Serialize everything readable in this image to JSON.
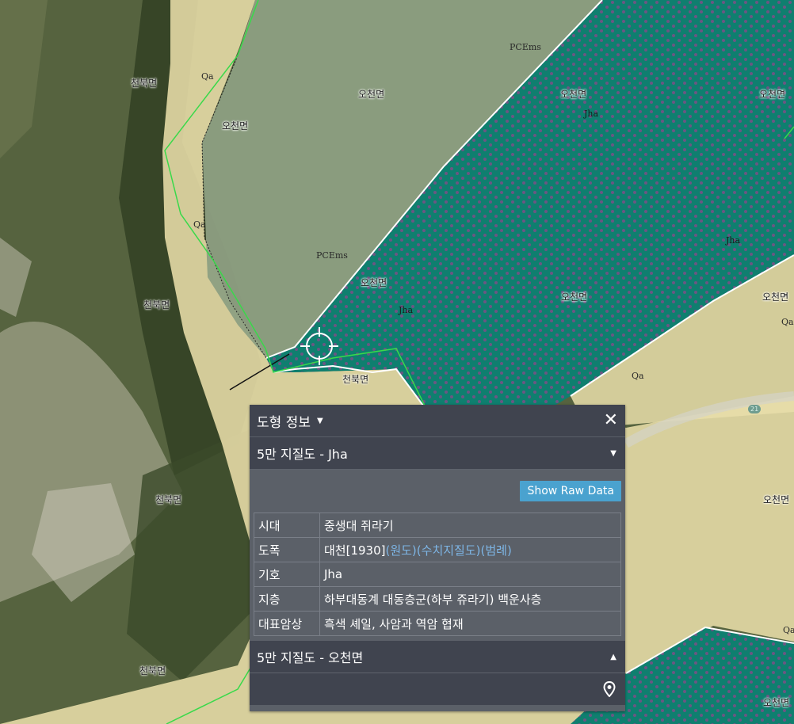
{
  "map": {
    "place_labels": [
      "천북면",
      "오천면",
      "천북면",
      "천북면",
      "오천면",
      "오천면",
      "천북면",
      "오천면",
      "오천면",
      "오천면",
      "오천면",
      "오천면",
      "오천면",
      "천북면"
    ],
    "unit_labels": [
      "PCEms",
      "PCEms",
      "Qa",
      "Qa",
      "Jha",
      "Jha",
      "Jha",
      "Qa",
      "Qa",
      "Qa"
    ],
    "road_number": "21",
    "colors": {
      "alluvium": "#e9deaa",
      "pcems": "#8d9f82",
      "jha": "#0f7f6f",
      "jha_dots": "#7c4f86",
      "boundary": "#39d94a"
    }
  },
  "panel": {
    "title": "도형 정보",
    "section1_title": "5만 지질도 - Jha",
    "raw_button": "Show Raw Data",
    "rows": [
      {
        "key": "시대",
        "value": "중생대 쥐라기"
      },
      {
        "key": "도폭",
        "value": "대천[1930]",
        "links": [
          "(원도)",
          "(수치지질도)",
          "(범례)"
        ]
      },
      {
        "key": "기호",
        "value": "Jha"
      },
      {
        "key": "지층",
        "value": "하부대동계 대동층군(하부 쥬라기) 백운사층"
      },
      {
        "key": "대표암상",
        "value": "흑색 셰일, 사암과 역암 협재"
      }
    ],
    "section2_title": "5만 지질도 - 오천면"
  }
}
